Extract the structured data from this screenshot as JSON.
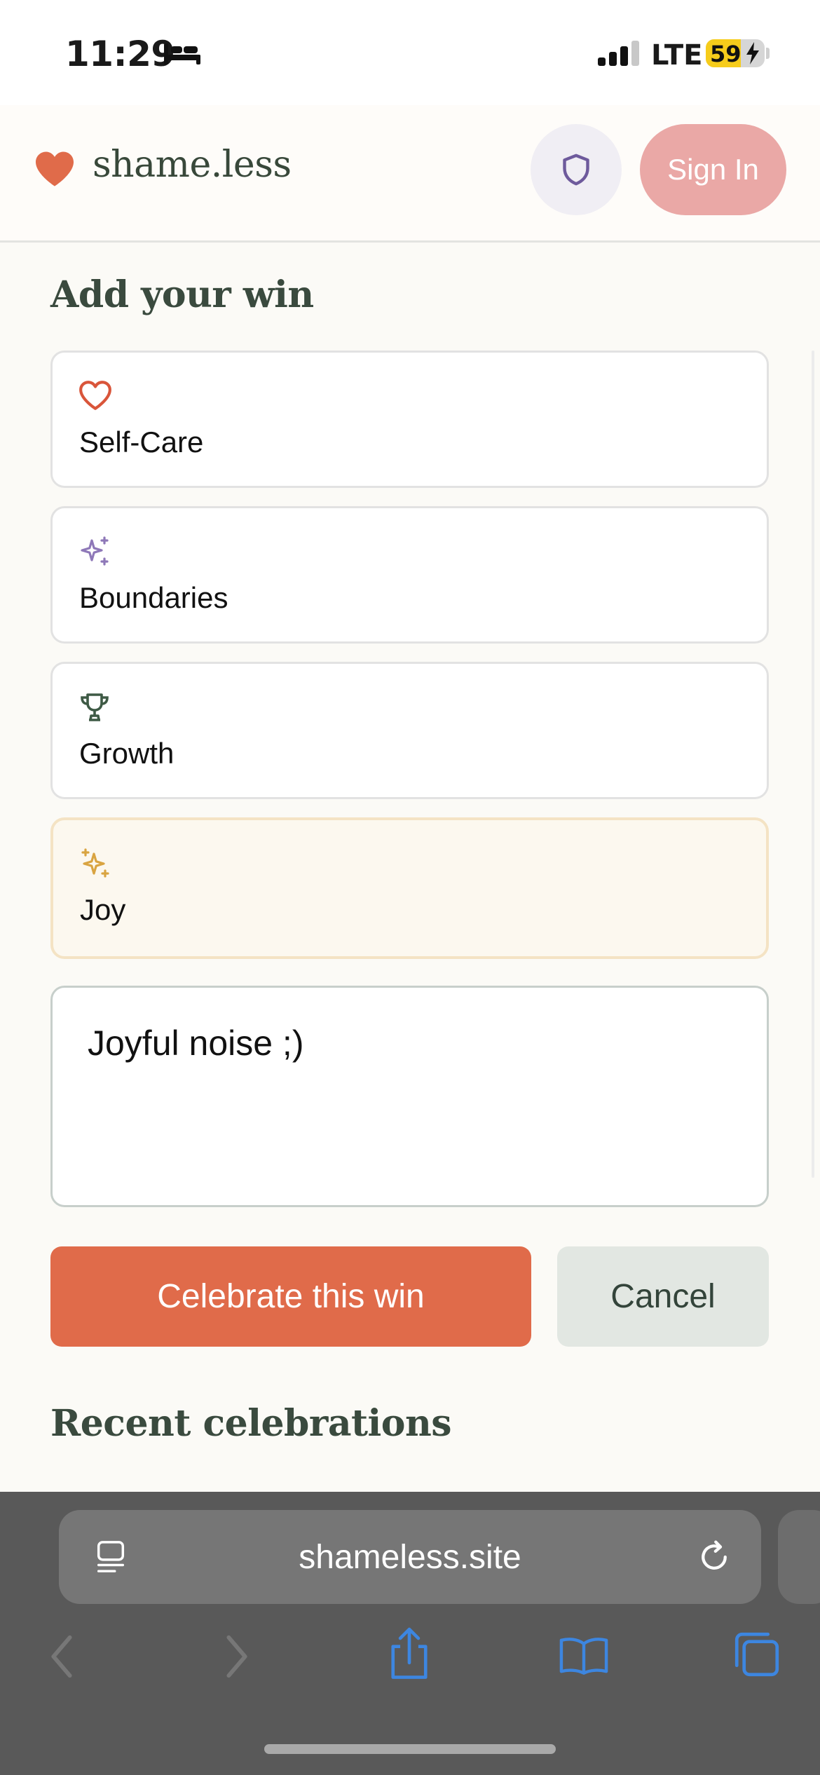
{
  "status_bar": {
    "time": "11:29",
    "network": "LTE",
    "battery": "59",
    "battery_level": 0.59,
    "icons": [
      "sleep-bed-icon",
      "cellular-signal-icon",
      "battery-charging-icon"
    ]
  },
  "header": {
    "brand": "shame.less",
    "brand_icon": "heart-icon",
    "privacy_icon": "shield-icon",
    "signin_label": "Sign In"
  },
  "form": {
    "title": "Add your win",
    "categories": [
      {
        "label": "Self-Care",
        "icon": "heart-outline-icon",
        "color": "#d9553a",
        "selected": false
      },
      {
        "label": "Boundaries",
        "icon": "sparkles-icon",
        "color": "#8e78b8",
        "selected": false
      },
      {
        "label": "Growth",
        "icon": "trophy-icon",
        "color": "#3e5a45",
        "selected": false
      },
      {
        "label": "Joy",
        "icon": "sparkles-icon",
        "color": "#d9a441",
        "selected": true
      }
    ],
    "text_value": "Joyful noise ;)",
    "celebrate_label": "Celebrate this win",
    "cancel_label": "Cancel"
  },
  "recent": {
    "title": "Recent celebrations"
  },
  "browser": {
    "url": "shameless.site"
  },
  "colors": {
    "accent": "#e06b4a",
    "signin": "#eaa8a6",
    "selected_bg": "#fcf8ef",
    "selected_border": "#f4e3c4",
    "ios_blue": "#3d86e0"
  }
}
